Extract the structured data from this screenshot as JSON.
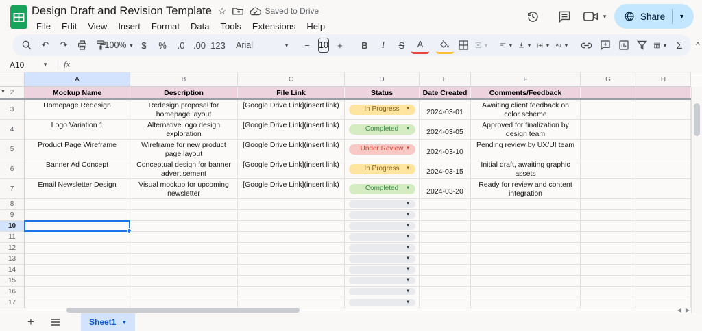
{
  "titlebar": {
    "title": "Design Draft and Revision Template",
    "saved_status": "Saved to Drive",
    "menus": [
      "File",
      "Edit",
      "View",
      "Insert",
      "Format",
      "Data",
      "Tools",
      "Extensions",
      "Help"
    ],
    "share_label": "Share"
  },
  "toolbar": {
    "zoom": "100%",
    "glyphs": {
      "currency": "$",
      "percent": "%",
      "dec_decimal": ".0",
      "inc_decimal": ".00",
      "more_formats": "123",
      "bold": "B",
      "italic": "I",
      "strikethrough": "S",
      "text_color": "A",
      "minus": "−",
      "plus": "+",
      "functions": "Σ",
      "collapse": "^"
    },
    "font_name": "Arial",
    "font_size": "10"
  },
  "formula_bar": {
    "cell_ref": "A10",
    "fx_label": "fx"
  },
  "grid": {
    "column_letters": [
      "A",
      "B",
      "C",
      "D",
      "E",
      "F",
      "G",
      "H"
    ],
    "selected_cell": "A10",
    "selected_column": "A",
    "selected_row": "10",
    "header_row": {
      "row_num": "2",
      "bg_color": "#ecd3dd",
      "labels": [
        "Mockup Name",
        "Description",
        "File Link",
        "Status",
        "Date Created",
        "Comments/Feedback",
        "",
        ""
      ]
    },
    "rows": [
      {
        "row_num": "3",
        "mockup_name": "Homepage Redesign",
        "description": "Redesign proposal for homepage layout",
        "file_link": "[Google Drive Link](insert link)",
        "status": "In Progress",
        "date_created": "2024-03-01",
        "comments": "Awaiting client feedback on color scheme"
      },
      {
        "row_num": "4",
        "mockup_name": "Logo Variation 1",
        "description": "Alternative logo design exploration",
        "file_link": "[Google Drive Link](insert link)",
        "status": "Completed",
        "date_created": "2024-03-05",
        "comments": "Approved for finalization by design team"
      },
      {
        "row_num": "5",
        "mockup_name": "Product Page Wireframe",
        "description": "Wireframe for new product page layout",
        "file_link": "[Google Drive Link](insert link)",
        "status": "Under Review",
        "date_created": "2024-03-10",
        "comments": "Pending review by UX/UI team"
      },
      {
        "row_num": "6",
        "mockup_name": "Banner Ad Concept",
        "description": "Conceptual design for banner advertisement",
        "file_link": "[Google Drive Link](insert link)",
        "status": "In Progress",
        "date_created": "2024-03-15",
        "comments": "Initial draft, awaiting graphic assets"
      },
      {
        "row_num": "7",
        "mockup_name": "Email Newsletter Design",
        "description": "Visual mockup for upcoming newsletter",
        "file_link": "[Google Drive Link](insert link)",
        "status": "Completed",
        "date_created": "2024-03-20",
        "comments": "Ready for review and content integration"
      }
    ],
    "empty_row_nums": [
      "8",
      "9",
      "10",
      "11",
      "12",
      "13",
      "14",
      "15",
      "16",
      "17"
    ],
    "status_styles": {
      "In Progress": {
        "bg": "#ffe5a0",
        "fg": "#8a6116"
      },
      "Completed": {
        "bg": "#d5ecc3",
        "fg": "#3d8a47"
      },
      "Under Review": {
        "bg": "#f9c9c5",
        "fg": "#cf4335"
      },
      "empty": {
        "bg": "#e8eaed",
        "fg": "#3c4043"
      }
    },
    "selection_color": "#1a73e8"
  },
  "bottombar": {
    "sheet_tab": "Sheet1"
  }
}
